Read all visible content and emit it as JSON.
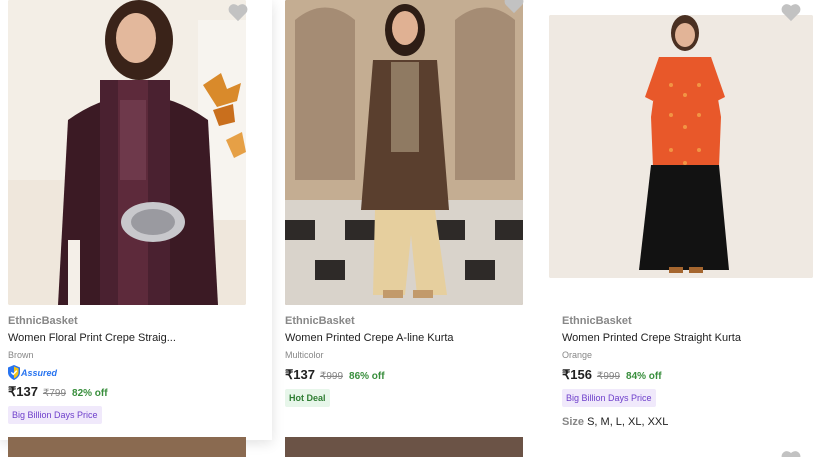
{
  "products": [
    {
      "brand": "EthnicBasket",
      "title": "Women Floral Print Crepe Straig...",
      "color": "Brown",
      "assured": "Assured",
      "price": "₹137",
      "mrp": "₹799",
      "discount": "82% off",
      "tag": "Big Billion Days Price"
    },
    {
      "brand": "EthnicBasket",
      "title": "Women Printed Crepe A-line Kurta",
      "color": "Multicolor",
      "price": "₹137",
      "mrp": "₹999",
      "discount": "86% off",
      "tag": "Hot Deal"
    },
    {
      "brand": "EthnicBasket",
      "title": "Women Printed Crepe Straight Kurta",
      "color": "Orange",
      "price": "₹156",
      "mrp": "₹999",
      "discount": "84% off",
      "tag": "Big Billion Days Price",
      "sizes_label": "Size",
      "sizes": "S, M, L, XL, XXL"
    }
  ],
  "icons": {
    "wishlist": "heart-icon",
    "assured": "shield-icon"
  },
  "colors": {
    "wishlist": "#c2c2c2",
    "price_off": "#388e3c",
    "assured_blue": "#2874f0",
    "bbd_tag_bg": "#f0e9fb",
    "bbd_tag_text": "#6e3fcb"
  }
}
